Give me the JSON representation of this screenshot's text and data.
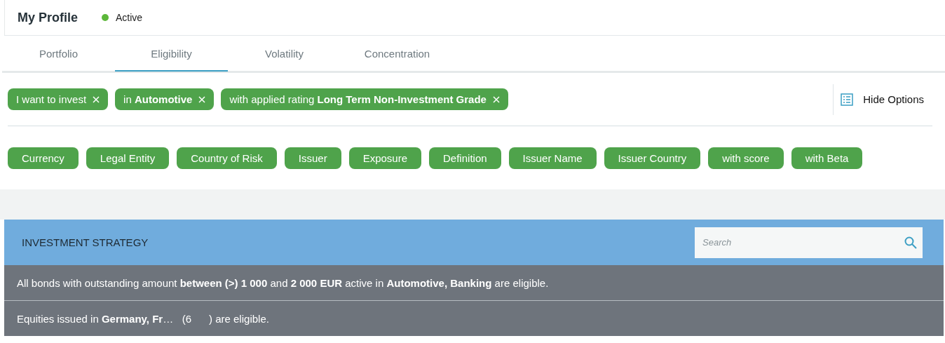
{
  "header": {
    "title": "My Profile",
    "status": {
      "label": "Active",
      "color": "#5cb73a"
    }
  },
  "tabs": [
    {
      "label": "Portfolio",
      "selected": false
    },
    {
      "label": "Eligibility",
      "selected": true
    },
    {
      "label": "Volatility",
      "selected": false
    },
    {
      "label": "Concentration",
      "selected": false
    }
  ],
  "filters": [
    {
      "text": "I want to invest"
    },
    {
      "text": "in **Automotive**"
    },
    {
      "text": "with applied rating **Long Term Non-Investment Grade**"
    }
  ],
  "hide_options": "Hide Options",
  "options": [
    "Currency",
    "Legal Entity",
    "Country of Risk",
    "Issuer",
    "Exposure",
    "Definition",
    "Issuer Name",
    "Issuer Country",
    "with score",
    "with Beta"
  ],
  "strategy": {
    "title": "INVESTMENT STRATEGY",
    "search": {
      "placeholder": "Search"
    },
    "rows": [
      "All bonds with outstanding amount **between (>) 1 000** and **2 000 EUR** active in **Automotive, Banking** are eligible.",
      "Equities issued in **Germany, Fr**…   (6      ) are eligible."
    ]
  }
}
